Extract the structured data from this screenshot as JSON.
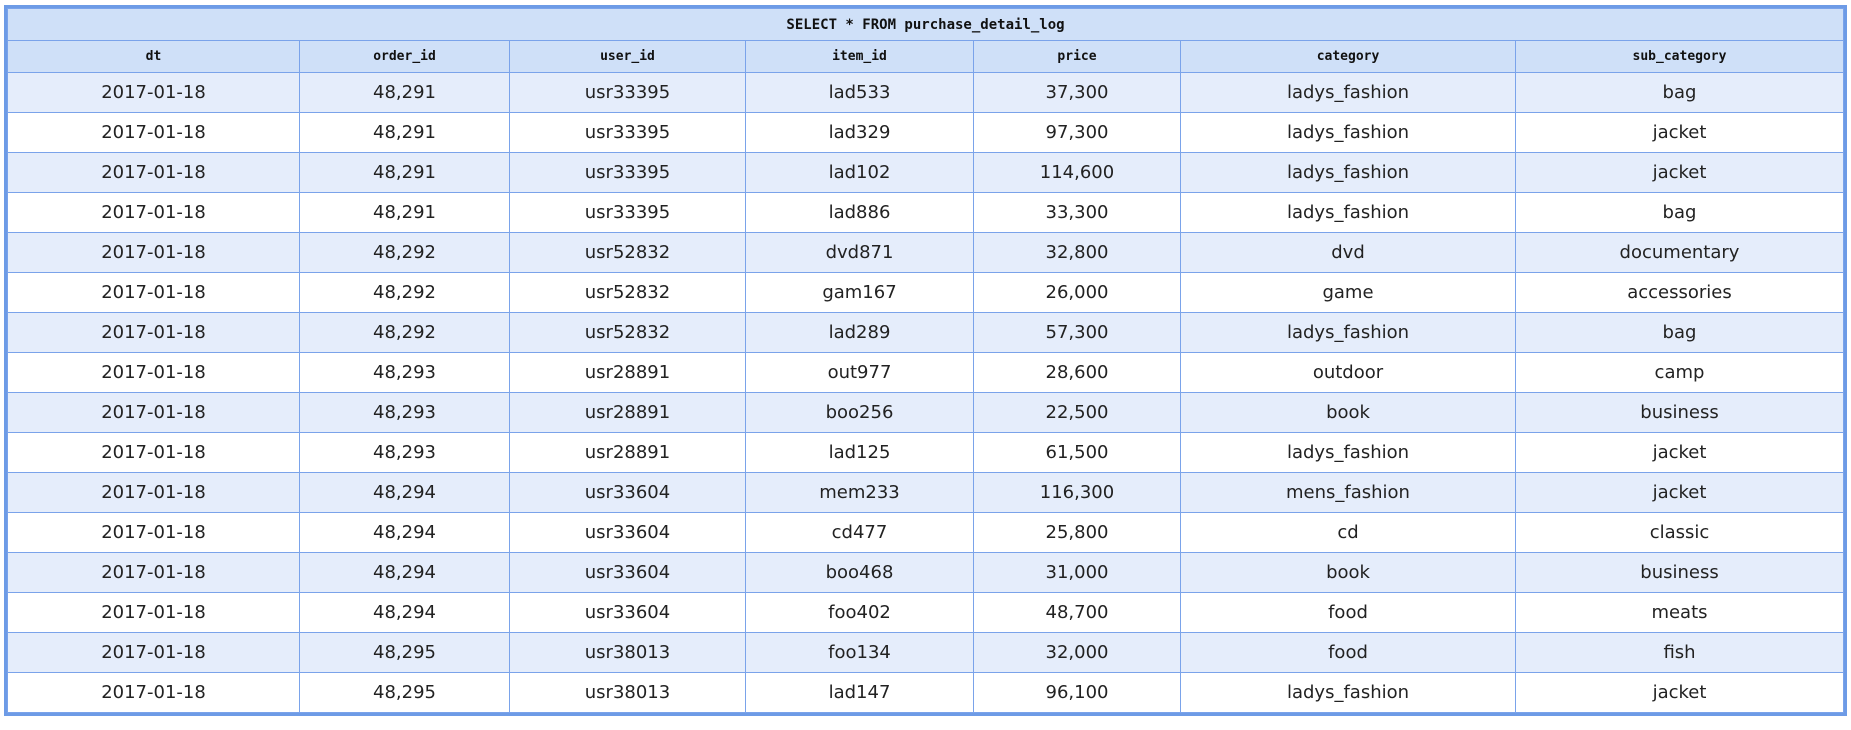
{
  "title": "SELECT * FROM purchase_detail_log",
  "columns": [
    "dt",
    "order_id",
    "user_id",
    "item_id",
    "price",
    "category",
    "sub_category"
  ],
  "rows": [
    [
      "2017-01-18",
      "48,291",
      "usr33395",
      "lad533",
      "37,300",
      "ladys_fashion",
      "bag"
    ],
    [
      "2017-01-18",
      "48,291",
      "usr33395",
      "lad329",
      "97,300",
      "ladys_fashion",
      "jacket"
    ],
    [
      "2017-01-18",
      "48,291",
      "usr33395",
      "lad102",
      "114,600",
      "ladys_fashion",
      "jacket"
    ],
    [
      "2017-01-18",
      "48,291",
      "usr33395",
      "lad886",
      "33,300",
      "ladys_fashion",
      "bag"
    ],
    [
      "2017-01-18",
      "48,292",
      "usr52832",
      "dvd871",
      "32,800",
      "dvd",
      "documentary"
    ],
    [
      "2017-01-18",
      "48,292",
      "usr52832",
      "gam167",
      "26,000",
      "game",
      "accessories"
    ],
    [
      "2017-01-18",
      "48,292",
      "usr52832",
      "lad289",
      "57,300",
      "ladys_fashion",
      "bag"
    ],
    [
      "2017-01-18",
      "48,293",
      "usr28891",
      "out977",
      "28,600",
      "outdoor",
      "camp"
    ],
    [
      "2017-01-18",
      "48,293",
      "usr28891",
      "boo256",
      "22,500",
      "book",
      "business"
    ],
    [
      "2017-01-18",
      "48,293",
      "usr28891",
      "lad125",
      "61,500",
      "ladys_fashion",
      "jacket"
    ],
    [
      "2017-01-18",
      "48,294",
      "usr33604",
      "mem233",
      "116,300",
      "mens_fashion",
      "jacket"
    ],
    [
      "2017-01-18",
      "48,294",
      "usr33604",
      "cd477",
      "25,800",
      "cd",
      "classic"
    ],
    [
      "2017-01-18",
      "48,294",
      "usr33604",
      "boo468",
      "31,000",
      "book",
      "business"
    ],
    [
      "2017-01-18",
      "48,294",
      "usr33604",
      "foo402",
      "48,700",
      "food",
      "meats"
    ],
    [
      "2017-01-18",
      "48,295",
      "usr38013",
      "foo134",
      "32,000",
      "food",
      "fish"
    ],
    [
      "2017-01-18",
      "48,295",
      "usr38013",
      "lad147",
      "96,100",
      "ladys_fashion",
      "jacket"
    ]
  ]
}
